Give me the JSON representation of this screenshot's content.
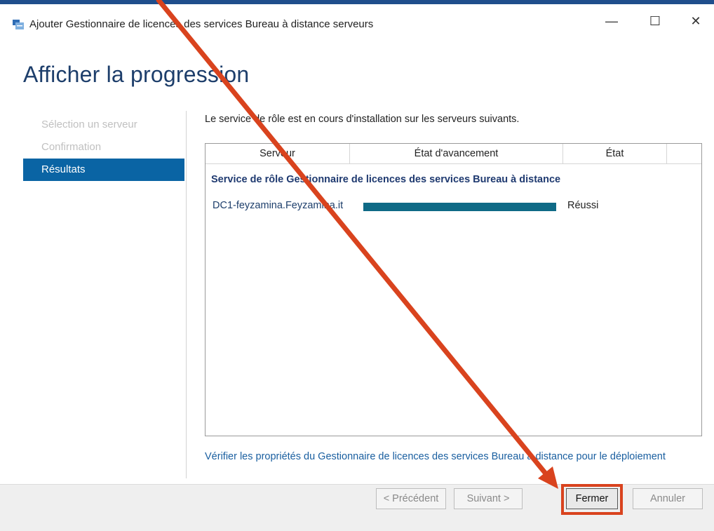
{
  "window": {
    "title": "Ajouter Gestionnaire de licences des services Bureau à distance serveurs",
    "controls": {
      "minimize": "—",
      "maximize": "☐",
      "close": "✕"
    }
  },
  "page": {
    "title": "Afficher la progression"
  },
  "nav": {
    "items": [
      {
        "label": "Sélection un serveur",
        "active": false
      },
      {
        "label": "Confirmation",
        "active": false
      },
      {
        "label": "Résultats",
        "active": true
      }
    ]
  },
  "content": {
    "intro": "Le service de rôle est en cours d'installation sur les serveurs suivants.",
    "table": {
      "columns": [
        "Serveur",
        "État d'avancement",
        "État"
      ],
      "group_title": "Service de rôle Gestionnaire de licences des services Bureau à distance",
      "rows": [
        {
          "server": "DC1-feyzamina.Feyzamina.it",
          "progress": 1.0,
          "state": "Réussi"
        }
      ]
    },
    "link": "Vérifier les propriétés du Gestionnaire de licences des services Bureau à distance pour le déploiement"
  },
  "footer": {
    "prev": "< Précédent",
    "next": "Suivant >",
    "close": "Fermer",
    "cancel": "Annuler"
  },
  "colors": {
    "accent": "#0a64a4",
    "progress": "#0f6a86",
    "annotation": "#d9431e"
  }
}
